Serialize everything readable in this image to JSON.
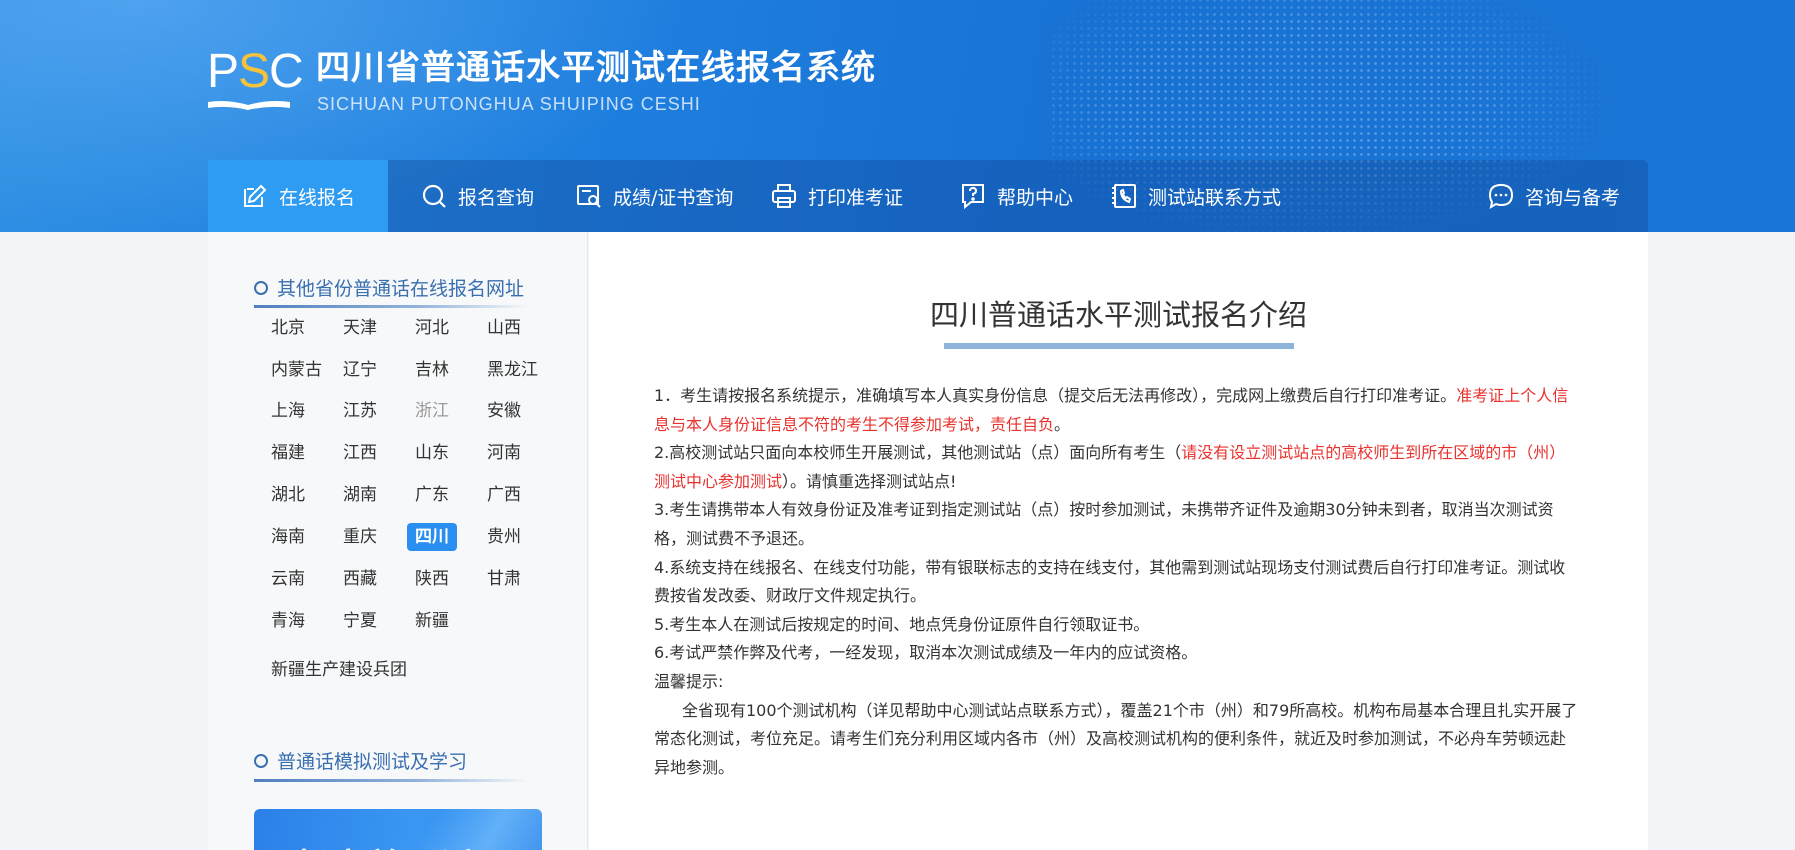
{
  "header": {
    "logo_text_p": "P",
    "logo_text_s": "S",
    "logo_text_c": "C",
    "title": "四川省普通话水平测试在线报名系统",
    "subtitle": "SICHUAN PUTONGHUA SHUIPING CESHI"
  },
  "nav": {
    "items": [
      {
        "label": "在线报名",
        "icon": "edit-icon"
      },
      {
        "label": "报名查询",
        "icon": "search-icon"
      },
      {
        "label": "成绩/证书查询",
        "icon": "certificate-search-icon"
      },
      {
        "label": "打印准考证",
        "icon": "printer-icon"
      },
      {
        "label": "帮助中心",
        "icon": "help-icon"
      },
      {
        "label": "测试站联系方式",
        "icon": "phone-icon"
      },
      {
        "label": "咨询与备考",
        "icon": "chat-icon"
      }
    ],
    "active_index": 0
  },
  "sidebar": {
    "section1_title": "其他省份普通话在线报名网址",
    "provinces": [
      "北京",
      "天津",
      "河北",
      "山西",
      "内蒙古",
      "辽宁",
      "吉林",
      "黑龙江",
      "上海",
      "江苏",
      "浙江",
      "安徽",
      "福建",
      "江西",
      "山东",
      "河南",
      "湖北",
      "湖南",
      "广东",
      "广西",
      "海南",
      "重庆",
      "四川",
      "贵州",
      "云南",
      "西藏",
      "陕西",
      "甘肃",
      "青海",
      "宁夏",
      "新疆"
    ],
    "extra_province": "新疆生产建设兵团",
    "current_province": "四川",
    "disabled_province": "浙江",
    "section2_title": "普通话模拟测试及学习",
    "promo_text": "畅享普通话"
  },
  "main": {
    "title": "四川普通话水平测试报名介绍",
    "p1_a": "1．考生请按报名系统提示，准确填写本人真实身份信息（提交后无法再修改），完成网上缴费后自行打印准考证。",
    "p1_red": "准考证上个人信息与本人身份证信息不符的考生不得参加考试，责任自负",
    "p1_end": "。",
    "p2_a": "2.高校测试站只面向本校师生开展测试，其他测试站（点）面向所有考生（",
    "p2_red": "请没有设立测试站点的高校师生到所在区域的市（州）测试中心参加测试",
    "p2_end": "）。请慎重选择测试站点!",
    "p3": "3.考生请携带本人有效身份证及准考证到指定测试站（点）按时参加测试，未携带齐证件及逾期30分钟未到者，取消当次测试资格，测试费不予退还。",
    "p4": "4.系统支持在线报名、在线支付功能，带有银联标志的支持在线支付，其他需到测试站现场支付测试费后自行打印准考证。测试收费按省发改委、财政厅文件规定执行。",
    "p5": "5.考生本人在测试后按规定的时间、地点凭身份证原件自行领取证书。",
    "p6": "6.考试严禁作弊及代考，一经发现，取消本次测试成绩及一年内的应试资格。",
    "tip_title": "温馨提示:",
    "tip_body": "全省现有100个测试机构（详见帮助中心测试站点联系方式），覆盖21个市（州）和79所高校。机构布局基本合理且扎实开展了常态化测试，考位充足。请考生们充分利用区域内各市（州）及高校测试机构的便利条件，就近及时参加测试，不必舟车劳顿远赴异地参测。"
  },
  "colors": {
    "header_blue": "#1e7ede",
    "nav_active": "#2f9cf3",
    "accent_red": "#e8322e",
    "logo_yellow": "#f5c23a",
    "current_province_bg": "#2a8ff0"
  }
}
